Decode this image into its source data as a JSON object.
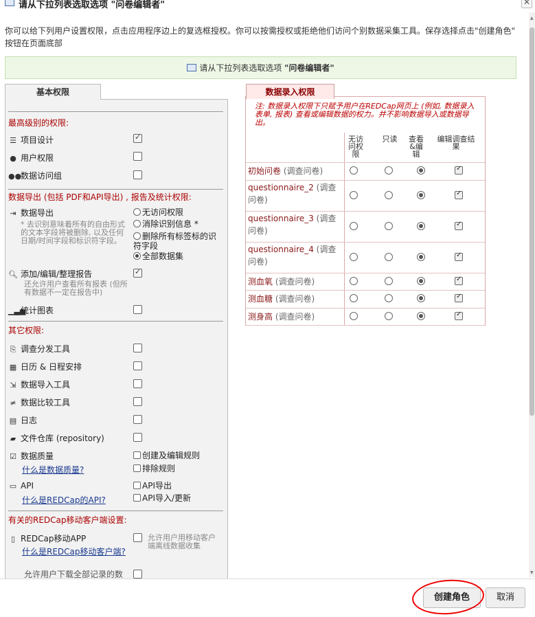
{
  "dialog": {
    "title_prefix": "请从下拉列表选取选项 ",
    "title_role": "\"问卷编辑者\"",
    "close_label": "✕",
    "intro": "你可以给下列用户设置权限，点击应用程序边上的复选框授权。你可以按需授权或拒绝他们访问个别数据采集工具。保存选择点击\"创建角色\" 按钮在页面底部",
    "banner_prefix": "请从下拉列表选取选项 ",
    "banner_role": "\"问卷编辑者\""
  },
  "basic": {
    "tab_label": "基本权限",
    "sec_top": "最高级别的权限:",
    "project_design": "项目设计",
    "user_rights": "用户权限",
    "dag": "数据访问组",
    "sec_export": "数据导出 (包括 PDF和API导出) , 报告及统计权限:",
    "data_export": "数据导出",
    "export_note": "* 去识别意味着所有的自由形式的文本字段将被删除, 以及任何日期/时间字段和标识符字段。",
    "export_opts": [
      "无访问权限",
      "消除识别信息 *",
      "删除所有标签标的识符字段",
      "全部数据集"
    ],
    "reports": "添加/编辑/整理报告",
    "reports_note": "还允许用户查看所有报表 (但所有数据不一定在报告中)",
    "stats": "统计图表",
    "sec_other": "其它权限:",
    "survey_dist": "调查分发工具",
    "calendar": "日历 & 日程安排",
    "import": "数据导入工具",
    "compare": "数据比较工具",
    "logging": "日志",
    "file_repo": "文件仓库 (repository)",
    "dq": "数据质量",
    "dq_link": "什么是数据质量?",
    "dq_opts": [
      "创建及编辑规则",
      "排除规则"
    ],
    "api": "API",
    "api_link": "什么是REDCap的API?",
    "api_opts": [
      "API导出",
      "API导入/更新"
    ],
    "sec_mobile": "有关的REDCap移动客户端设置:",
    "mobile_app": "REDCap移动APP",
    "mobile_link": "什么是REDCap移动客户端?",
    "mobile_note": "允许用户用移动客户端离线数据收集",
    "download_all": "允许用户下载全部记录的数"
  },
  "data_entry": {
    "tab_label": "数据录入权限",
    "note": "注: 数据录入权限下只赋予用户在REDCap网页上 (例如, 数据录入表单, 报表) 查看或编辑数据的权力。并不影响数据导入或数据导出。",
    "col_none": "无访问权限",
    "col_readonly": "只读",
    "col_view_edit": "查看&编辑",
    "col_edit_survey": "编辑调查结果",
    "rows": [
      {
        "name": "初始问卷",
        "suffix": " (调查问卷)"
      },
      {
        "name": "questionnaire_2",
        "suffix": " (调查问卷)"
      },
      {
        "name": "questionnaire_3",
        "suffix": " (调查问卷)"
      },
      {
        "name": "questionnaire_4",
        "suffix": " (调查问卷)"
      },
      {
        "name": "测血氧",
        "suffix": " (调查问卷)"
      },
      {
        "name": "测血糖",
        "suffix": " (调查问卷)"
      },
      {
        "name": "测身高",
        "suffix": " (调查问卷)"
      }
    ]
  },
  "footer": {
    "create_label": "创建角色",
    "cancel_label": "取消"
  },
  "colors": {
    "section_heading": "#aa0000",
    "banner_bg": "#eef7e6",
    "data_entry_tab_bg": "#ffe9e9",
    "annotation_circle": "#ee0000"
  }
}
